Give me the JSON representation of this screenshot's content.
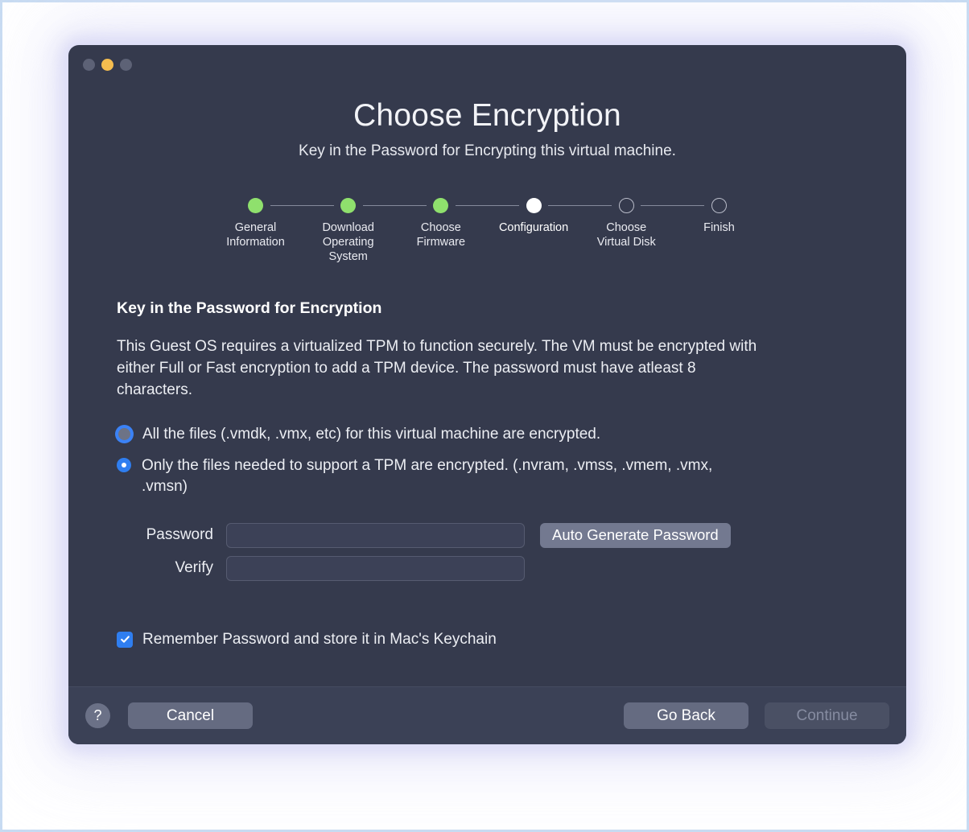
{
  "window": {
    "traffic_lights": [
      {
        "name": "close",
        "color": "#5d6276"
      },
      {
        "name": "minimize",
        "color": "#f5bd4f"
      },
      {
        "name": "zoom",
        "color": "#5d6276"
      }
    ]
  },
  "header": {
    "title": "Choose Encryption",
    "subtitle": "Key in the Password for Encrypting this virtual machine."
  },
  "stepper": {
    "steps": [
      {
        "label": "General\nInformation",
        "state": "done"
      },
      {
        "label": "Download\nOperating\nSystem",
        "state": "done"
      },
      {
        "label": "Choose\nFirmware",
        "state": "done"
      },
      {
        "label": "Configuration",
        "state": "current"
      },
      {
        "label": "Choose\nVirtual Disk",
        "state": "todo"
      },
      {
        "label": "Finish",
        "state": "todo"
      }
    ],
    "colors": {
      "done": "#8fe06d",
      "current": "#ffffff",
      "todo_stroke": "#b9bcc9",
      "connector": "#858a9c"
    }
  },
  "main": {
    "section_title": "Key in the Password for Encryption",
    "description": "This Guest OS requires a virtualized TPM to function securely. The VM must be encrypted with either Full or Fast encryption to add a TPM device. The password must have atleast 8 characters.",
    "encryption_options": [
      {
        "label": "All the files (.vmdk, .vmx, etc) for this virtual machine are encrypted.",
        "selected": false,
        "focused": true
      },
      {
        "label": "Only the files needed to support a TPM are encrypted. (.nvram, .vmss, .vmem, .vmx, .vmsn)",
        "selected": true,
        "focused": false
      }
    ],
    "form": {
      "password_label": "Password",
      "password_value": "",
      "password_placeholder": "",
      "verify_label": "Verify",
      "verify_value": "",
      "verify_placeholder": "",
      "auto_generate_label": "Auto Generate Password"
    },
    "remember": {
      "label": "Remember Password and store it in Mac's Keychain",
      "checked": true,
      "color": "#2f7ef0"
    }
  },
  "footer": {
    "help_label": "?",
    "cancel_label": "Cancel",
    "go_back_label": "Go Back",
    "continue_label": "Continue",
    "continue_enabled": false
  },
  "theme": {
    "window_bg": "#353a4d",
    "footer_bg": "#3b4156",
    "text": "#eceef3",
    "accent_blue": "#2f7ef0",
    "page_border": "#c7dbf2"
  }
}
